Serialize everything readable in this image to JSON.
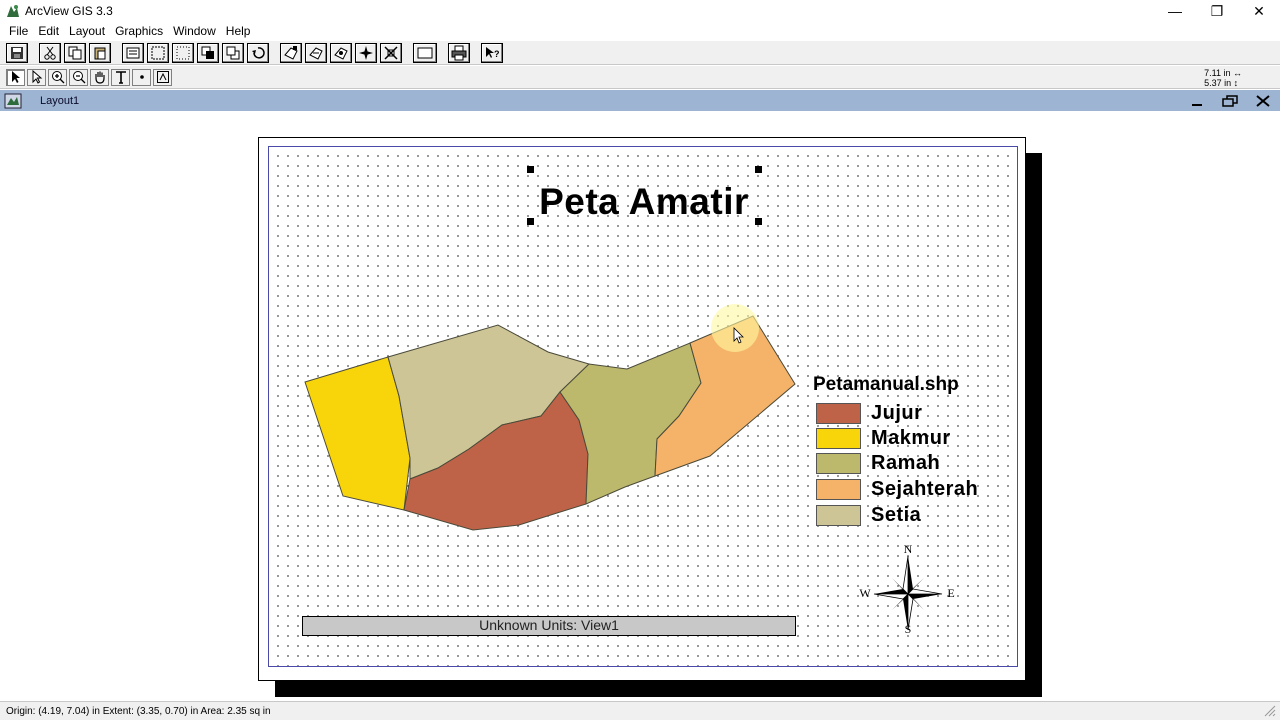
{
  "app": {
    "title": "ArcView GIS 3.3",
    "window_controls": {
      "minimize": "—",
      "restore": "❐",
      "close": "✕"
    }
  },
  "menu": [
    "File",
    "Edit",
    "Layout",
    "Graphics",
    "Window",
    "Help"
  ],
  "toolbar": {
    "buttons": [
      "save-icon",
      "cut-icon",
      "copy-icon",
      "paste-icon",
      "properties-icon",
      "select-all-icon",
      "deselect-icon",
      "bring-front-icon",
      "send-back-icon",
      "undo-icon",
      "frame-view-icon",
      "frame-legend-icon",
      "frame-scale-icon",
      "frame-north-icon",
      "frame-chart-icon",
      "frame-blank-icon",
      "print-icon",
      "help-icon"
    ],
    "tools": [
      "pointer-icon",
      "vertex-icon",
      "zoom-in-icon",
      "zoom-out-icon",
      "pan-icon",
      "text-icon",
      "point-icon",
      "frame-icon"
    ],
    "dims": {
      "width": "7.11 in",
      "height": "5.37 in"
    }
  },
  "document": {
    "title": "Layout1"
  },
  "layout": {
    "map_title": "Peta Amatir",
    "legend": {
      "title": "Petamanual.shp",
      "items": [
        {
          "label": "Jujur",
          "color": "#bf6348"
        },
        {
          "label": "Makmur",
          "color": "#f8d50b"
        },
        {
          "label": "Ramah",
          "color": "#bcb86c"
        },
        {
          "label": "Sejahterah",
          "color": "#f5b36a"
        },
        {
          "label": "Setia",
          "color": "#cdc595"
        }
      ]
    },
    "scalebar_text": "Unknown Units: View1",
    "north_arrow": {
      "n": "N",
      "s": "S",
      "e": "E",
      "w": "W"
    }
  },
  "status": {
    "text": "Origin: (4.19, 7.04) in  Extent: (3.35, 0.70) in  Area: 2.35 sq in"
  }
}
